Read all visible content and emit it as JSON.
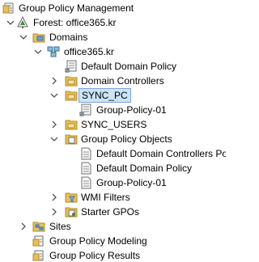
{
  "tree": {
    "root": {
      "label": "Group Policy Management",
      "icon": "gpm-root-icon"
    },
    "forest": {
      "label": "Forest: office365.kr",
      "icon": "forest-icon",
      "expanded": true
    },
    "domains": {
      "label": "Domains",
      "icon": "domains-folder-icon",
      "expanded": true
    },
    "domain": {
      "label": "office365.kr",
      "icon": "domain-icon",
      "expanded": true
    },
    "default_domain_policy_link": {
      "label": "Default Domain Policy",
      "icon": "gpo-link-icon"
    },
    "domain_controllers": {
      "label": "Domain Controllers",
      "icon": "ou-folder-icon",
      "expanded": false
    },
    "sync_pc": {
      "label": "SYNC_PC",
      "icon": "ou-folder-icon",
      "expanded": true,
      "selected": true
    },
    "group_policy_01_link": {
      "label": "Group-Policy-01",
      "icon": "gpo-link-icon"
    },
    "sync_users": {
      "label": "SYNC_USERS",
      "icon": "ou-folder-icon",
      "expanded": false
    },
    "group_policy_objects": {
      "label": "Group Policy Objects",
      "icon": "gpo-container-folder-icon",
      "expanded": true
    },
    "gpo_default_dc": {
      "label": "Default Domain Controllers Po",
      "icon": "gpo-icon"
    },
    "gpo_default_domain": {
      "label": "Default Domain Policy",
      "icon": "gpo-icon"
    },
    "gpo_group_policy_01": {
      "label": "Group-Policy-01",
      "icon": "gpo-icon"
    },
    "wmi_filters": {
      "label": "WMI Filters",
      "icon": "wmi-folder-icon",
      "expanded": false
    },
    "starter_gpos": {
      "label": "Starter GPOs",
      "icon": "starter-folder-icon",
      "expanded": false
    },
    "sites": {
      "label": "Sites",
      "icon": "sites-icon",
      "expanded": false
    },
    "modeling": {
      "label": "Group Policy Modeling",
      "icon": "modeling-icon"
    },
    "results": {
      "label": "Group Policy Results",
      "icon": "results-icon"
    }
  },
  "colors": {
    "selection_bg": "#cce4f7",
    "selection_border": "#7aa7d8",
    "folder": "#e8c05a",
    "expander": "#555555"
  }
}
